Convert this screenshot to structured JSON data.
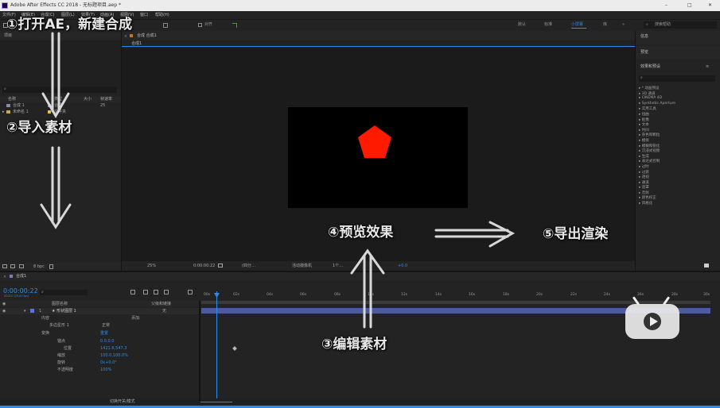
{
  "window": {
    "title": "Adobe After Effects CC 2018 - 无标题项目.aep *",
    "controls": [
      "–",
      "□",
      "✕"
    ]
  },
  "menu": [
    "文件(F)",
    "编辑(E)",
    "合成(C)",
    "图层(L)",
    "效果(T)",
    "动画(A)",
    "视图(V)",
    "窗口",
    "帮助(H)"
  ],
  "toolbar": {
    "snap_label": "对齐",
    "workspaces": [
      "默认",
      "标准",
      "小屏幕",
      "库"
    ],
    "active_workspace": "小屏幕",
    "search_help": "搜索帮助"
  },
  "overlay": {
    "step1": "①打开AE，新建合成",
    "step2": "②导入素材",
    "step3": "③编辑素材",
    "step4": "④预览效果",
    "step5": "⑤导出渲染"
  },
  "project": {
    "title": "项目",
    "columns": [
      "名称",
      "类型",
      "大小",
      "帧速率"
    ],
    "items": [
      {
        "name": "合成 1",
        "type": "合成",
        "size": "",
        "fps": "25"
      },
      {
        "name": "未命名 1",
        "type": "文件夹",
        "size": "",
        "fps": ""
      }
    ],
    "bpc": "8 bpc"
  },
  "viewer": {
    "tab_label": "合成 合成1",
    "sub_tab": "合成1",
    "zoom": "25%",
    "timecode": "0:00:00:22",
    "resolution": "(四分…",
    "camera": "活动摄像机",
    "views": "1个…",
    "exposure": "+0.0"
  },
  "right_panel": {
    "info": "信息",
    "preview": "预览",
    "effects_title": "效果和预设",
    "effects": [
      "* 动画预设",
      "3D 通道",
      "CINEMA 4D",
      "Synthetic Aperture",
      "实用工具",
      "扭曲",
      "抠像",
      "文本",
      "时间",
      "杂色和颗粒",
      "模拟",
      "模糊和锐化",
      "沉浸式视频",
      "生成",
      "表达式控制",
      "过时",
      "过渡",
      "透视",
      "通道",
      "遮罩",
      "音频",
      "颜色校正",
      "风格化"
    ]
  },
  "timeline": {
    "tab_label": "合成1",
    "timecode": "0:00:00:22",
    "frame_sub": "00022 (25.00 fps)",
    "columns": {
      "layer_name": "图层名称",
      "parent": "父级和链接",
      "switches_modes": "切换开关/模式"
    },
    "add_label": "添加:",
    "layers": [
      {
        "index": "1",
        "name": "★ 形状图层 1",
        "parent": "无"
      }
    ],
    "properties": [
      {
        "label": "内容",
        "value": ""
      },
      {
        "label": "多边星形 1",
        "value": "正常"
      },
      {
        "label": "变换",
        "value": "重置"
      },
      {
        "label": "锚点",
        "value": "0.0,0.0"
      },
      {
        "label": "位置",
        "value": "1421.6,547.3"
      },
      {
        "label": "缩放",
        "value": "100.0,100.0%"
      },
      {
        "label": "旋转",
        "value": "0x+0.0°"
      },
      {
        "label": "不透明度",
        "value": "100%"
      }
    ],
    "ruler": [
      "00s",
      "02s",
      "04s",
      "06s",
      "08s",
      "10s",
      "12s",
      "14s",
      "16s",
      "18s",
      "20s",
      "22s",
      "24s",
      "26s",
      "28s",
      "30s"
    ]
  },
  "colors": {
    "accent": "#2d8ceb",
    "pentagon": "#ff1a00",
    "layer_bar": "#4d5b9e",
    "workspace_active": "#2d8ceb"
  }
}
